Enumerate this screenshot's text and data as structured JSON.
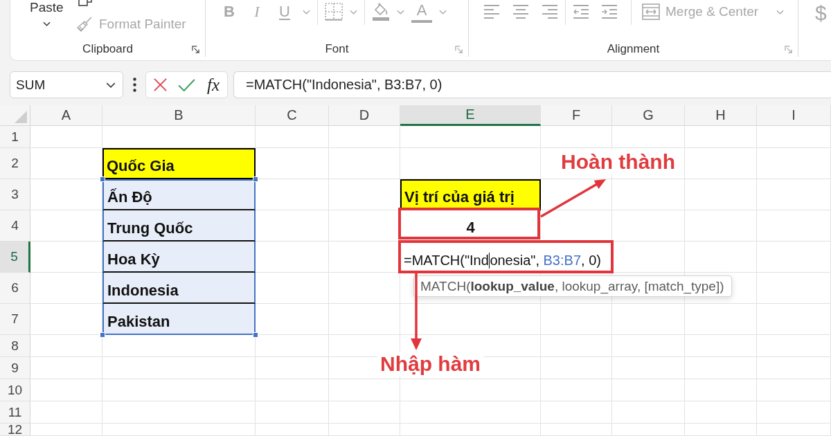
{
  "ribbon": {
    "clipboard": {
      "label": "Clipboard",
      "disabled": false,
      "paste": {
        "label": "Paste",
        "disabled": false
      },
      "format_painter": {
        "label": "Format Painter",
        "disabled": true
      }
    },
    "font": {
      "label": "Font",
      "disabled": true,
      "bold": "B",
      "italic": "I",
      "underline": "U",
      "font_color": "A"
    },
    "alignment": {
      "label": "Alignment",
      "disabled": true,
      "merge": "Merge & Center"
    },
    "number": {
      "currency": "$",
      "disabled": true
    }
  },
  "formula_bar": {
    "name_box": "SUM",
    "insert_function": "fx",
    "formula": "=MATCH(\"Indonesia\", B3:B7, 0)"
  },
  "sheet": {
    "columns": [
      {
        "label": "A",
        "selected": false
      },
      {
        "label": "B",
        "selected": false
      },
      {
        "label": "C",
        "selected": false
      },
      {
        "label": "D",
        "selected": false
      },
      {
        "label": "E",
        "selected": true
      },
      {
        "label": "F",
        "selected": false
      },
      {
        "label": "G",
        "selected": false
      },
      {
        "label": "H",
        "selected": false
      },
      {
        "label": "I",
        "selected": false
      }
    ],
    "rows": [
      {
        "label": "1",
        "selected": false
      },
      {
        "label": "2",
        "selected": false,
        "cells": [
          {
            "kind": "empty"
          },
          {
            "kind": "heading",
            "text": "Quốc Gia",
            "highlighted": false
          }
        ]
      },
      {
        "label": "3",
        "selected": false,
        "cells": [
          {
            "kind": "empty"
          },
          {
            "kind": "listed",
            "text": "Ấn Độ",
            "highlighted": true
          },
          {
            "kind": "empty"
          },
          {
            "kind": "empty"
          },
          {
            "kind": "heading",
            "text": "Vị trí của giá trị",
            "highlighted": false
          }
        ]
      },
      {
        "label": "4",
        "selected": false,
        "cells": [
          {
            "kind": "empty"
          },
          {
            "kind": "listed",
            "text": "Trung Quốc",
            "highlighted": true
          },
          {
            "kind": "empty"
          },
          {
            "kind": "empty"
          },
          {
            "kind": "result",
            "text": "4",
            "highlighted": false
          }
        ]
      },
      {
        "label": "5",
        "selected": true,
        "cells": [
          {
            "kind": "empty"
          },
          {
            "kind": "listed",
            "text": "Hoa Kỳ",
            "highlighted": true
          },
          {
            "kind": "empty"
          },
          {
            "kind": "empty"
          },
          {
            "kind": "editing",
            "highlighted": false,
            "parts": [
              {
                "kind": "text",
                "text": "=MATCH(\"Ind"
              },
              {
                "kind": "cursor"
              },
              {
                "kind": "text",
                "text": "onesia\", "
              },
              {
                "kind": "reference",
                "text": "B3:B7"
              },
              {
                "kind": "text",
                "text": ", 0)"
              }
            ]
          }
        ]
      },
      {
        "label": "6",
        "selected": false,
        "cells": [
          {
            "kind": "empty"
          },
          {
            "kind": "listed",
            "text": "Indonesia",
            "highlighted": true
          }
        ]
      },
      {
        "label": "7",
        "selected": false,
        "cells": [
          {
            "kind": "empty"
          },
          {
            "kind": "listed",
            "text": "Pakistan",
            "highlighted": true
          }
        ]
      },
      {
        "label": "8",
        "selected": false
      },
      {
        "label": "9",
        "selected": false
      },
      {
        "label": "10",
        "selected": false
      },
      {
        "label": "11",
        "selected": false
      },
      {
        "label": "12",
        "selected": false
      }
    ]
  },
  "function_tooltip": "MATCH(**lookup_value**, lookup_array, [match_type])",
  "annotations": {
    "result_note": "Hoàn thành",
    "formula_note": "Nhập hàm"
  }
}
